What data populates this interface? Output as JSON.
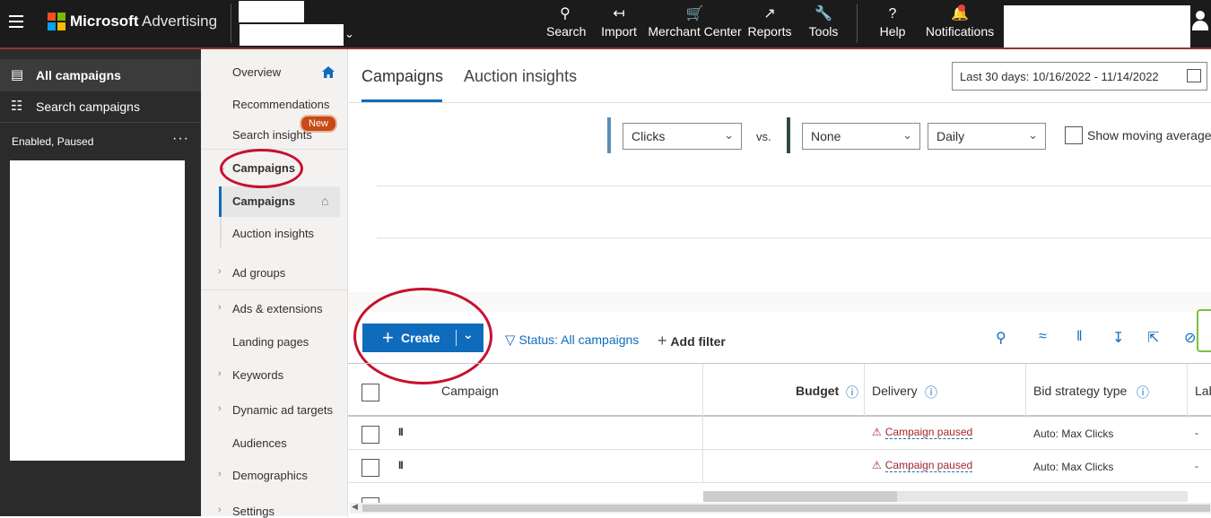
{
  "brand": {
    "name": "Microsoft",
    "product": "Advertising"
  },
  "topnav": [
    {
      "label": "Search",
      "icon": "search-icon"
    },
    {
      "label": "Import",
      "icon": "import-icon"
    },
    {
      "label": "Merchant Center",
      "icon": "cart-icon"
    },
    {
      "label": "Reports",
      "icon": "chart-icon"
    },
    {
      "label": "Tools",
      "icon": "wrench-icon"
    },
    {
      "label": "Help",
      "icon": "question-icon"
    },
    {
      "label": "Notifications",
      "icon": "bell-icon"
    }
  ],
  "left_panel": {
    "all_campaigns": "All campaigns",
    "search_campaigns": "Search campaigns",
    "status_filter": "Enabled, Paused",
    "more": "···"
  },
  "subnav": {
    "overview": "Overview",
    "recommendations": "Recommendations",
    "search_insights": "Search insights",
    "new_badge": "New",
    "campaigns_group": "Campaigns",
    "campaigns": "Campaigns",
    "auction_insights": "Auction insights",
    "ad_groups": "Ad groups",
    "ads_extensions": "Ads & extensions",
    "landing_pages": "Landing pages",
    "keywords": "Keywords",
    "dynamic_ad_targets": "Dynamic ad targets",
    "audiences": "Audiences",
    "demographics": "Demographics",
    "settings": "Settings"
  },
  "tabs": {
    "campaigns": "Campaigns",
    "auction_insights": "Auction insights"
  },
  "date_range": "Last 30 days: 10/16/2022 - 11/14/2022",
  "chart_controls": {
    "metric1": "Clicks",
    "vs": "vs.",
    "metric2": "None",
    "granularity": "Daily",
    "moving_average": "Show moving average"
  },
  "toolbar": {
    "create": "Create",
    "status_filter": "Status: All campaigns",
    "add_filter": "Add filter"
  },
  "table": {
    "headers": {
      "campaign": "Campaign",
      "budget": "Budget",
      "delivery": "Delivery",
      "bid_strategy": "Bid strategy type",
      "labels": "Lab"
    },
    "rows": [
      {
        "status": "II",
        "delivery": "Campaign paused",
        "bid_strategy": "Auto: Max Clicks",
        "labels": "-"
      },
      {
        "status": "II",
        "delivery": "Campaign paused",
        "bid_strategy": "Auto: Max Clicks",
        "labels": "-"
      }
    ]
  },
  "colors": {
    "accent": "#0f6cbd",
    "topbar": "#1b1b1b",
    "annotation": "#c8102e",
    "warning": "#a4262c"
  }
}
